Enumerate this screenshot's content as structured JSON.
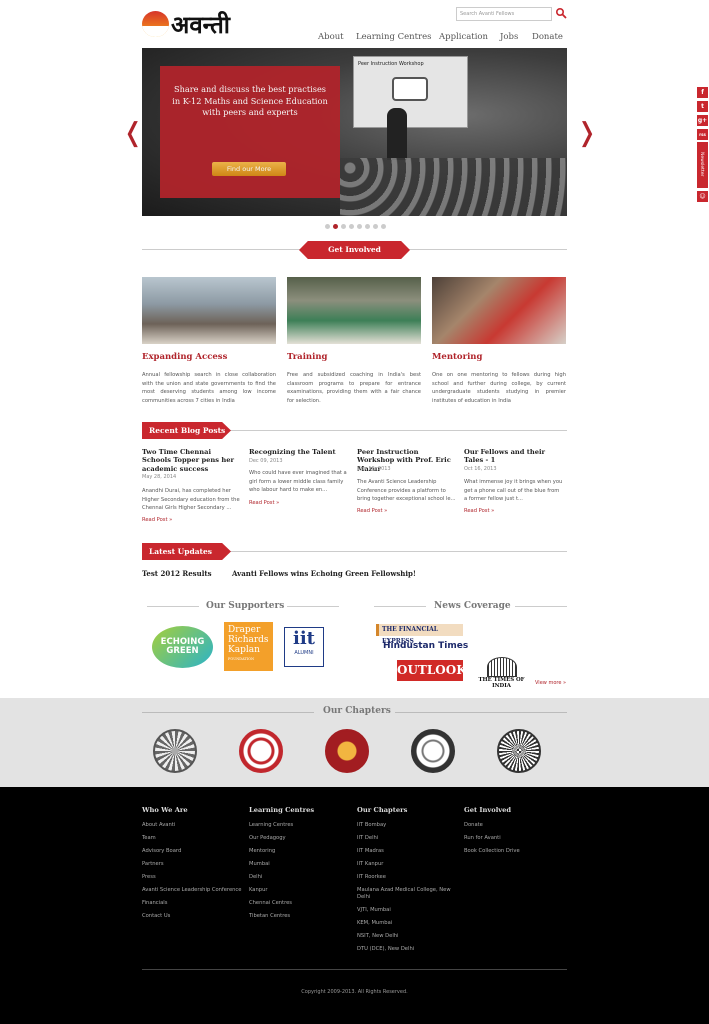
{
  "header": {
    "logo_text": "अवन्ती",
    "search_placeholder": "Search Avanti Fellows",
    "nav": [
      "About",
      "Learning Centres",
      "Application",
      "Jobs",
      "Donate"
    ]
  },
  "hero": {
    "headline": "Share and discuss the best practises in K-12 Maths and Science Education with peers and experts",
    "button": "Find our More",
    "screen_title": "Peer Instruction Workshop",
    "active_dot": 2,
    "dot_count": 8
  },
  "get_involved": {
    "title": "Get Involved",
    "cards": [
      {
        "title": "Expanding Access",
        "text": "Annual fellowship search in close collaboration with the union and state governments to find the most deserving students among low income communities across 7 cities in India"
      },
      {
        "title": "Training",
        "text": "Free and subsidized coaching in India's best classroom programs to prepare for entrance examinations, providing them with a fair chance for selection."
      },
      {
        "title": "Mentoring",
        "text": "One on one mentoring to fellows during high school and further during college, by current undergraduate students studying in premier institutes of education in India"
      }
    ]
  },
  "blog": {
    "title": "Recent Blog Posts",
    "posts": [
      {
        "title": "Two Time Chennai Schools Topper pens her academic success",
        "date": "May 28, 2014",
        "text": "Anandhi Durai, has completed her Higher Secondary education from the Chennai Girls Higher Secondary ...",
        "link": "Read Post »"
      },
      {
        "title": "Recognizing the Talent",
        "date": "Dec 09, 2013",
        "text": "Who could have ever imagined that a girl form a lower middle class family who labour hard to make en...",
        "link": "Read Post »"
      },
      {
        "title": "Peer Instruction Workshop with Prof. Eric Mazur",
        "date": "Nov 16, 2013",
        "text": "The Avanti Science Leadership Conference provides a platform to bring together exceptional school le...",
        "link": "Read Post »"
      },
      {
        "title": "Our Fellows and their Tales - 1",
        "date": "Oct 16, 2013",
        "text": "What immense joy it brings when you get a phone call out of the blue from a former fellow just t...",
        "link": "Read Post »"
      }
    ]
  },
  "updates": {
    "title": "Latest Updates",
    "items": [
      "Test 2012 Results",
      "Avanti Fellows wins Echoing Green Fellowship!"
    ]
  },
  "supporters": {
    "title": "Our Supporters",
    "echoing_green": "ECHOING GREEN",
    "drk": "Draper Richards Kaplan",
    "drk_sub": "FOUNDATION",
    "iit": "iit",
    "iit_sub": "ALUMNI"
  },
  "news": {
    "title": "News Coverage",
    "financial_express": "THE FINANCIAL EXPRESS",
    "hindustan_times": "Hindustan Times",
    "outlook": "OUTLOOK",
    "toi": "THE TIMES OF INDIA",
    "view_more": "View more »"
  },
  "chapters": {
    "title": "Our Chapters"
  },
  "footer": {
    "columns": [
      {
        "title": "Who We Are",
        "links": [
          "About Avanti",
          "Team",
          "Advisory Board",
          "Partners",
          "Press",
          "Avanti Science Leadership Conference",
          "Financials",
          "Contact Us"
        ]
      },
      {
        "title": "Learning Centres",
        "links": [
          "Learning Centres",
          "Our Pedagogy",
          "Mentoring",
          "Mumbai",
          "Delhi",
          "Kanpur",
          "Chennai Centres",
          "Tibetan Centres"
        ]
      },
      {
        "title": "Our Chapters",
        "links": [
          "IIT Bombay",
          "IIT Delhi",
          "IIT Madras",
          "IIT Kanpur",
          "IIT Roorkee",
          "Maulana Azad Medical College, New Delhi",
          "VJTI, Mumbai",
          "KEM, Mumbai",
          "NSIT, New Delhi",
          "DTU (DCE), New Delhi"
        ]
      },
      {
        "title": "Get Involved",
        "links": [
          "Donate",
          "Run for Avanti",
          "Book Collection Drive"
        ]
      }
    ],
    "copyright": "Copyright 2009-2013. All Rights Reserved."
  },
  "social": {
    "items": [
      "f",
      "t",
      "g+",
      "rss"
    ],
    "newsletter": "Newsletter",
    "colors": {
      "brand_red": "#c9272e",
      "gold": "#f5b94a"
    }
  }
}
